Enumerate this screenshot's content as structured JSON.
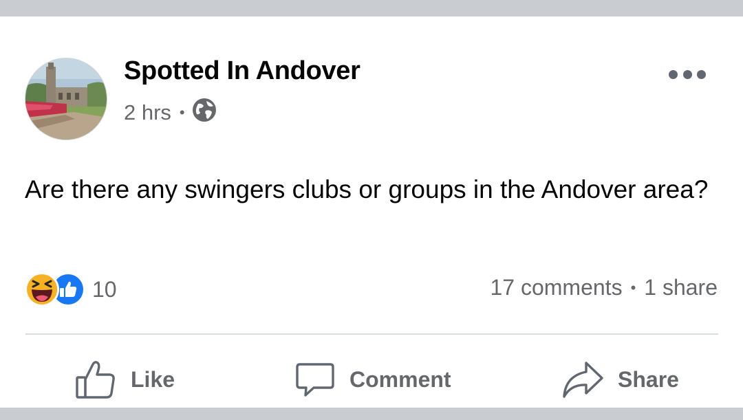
{
  "post": {
    "page_name": "Spotted In Andover",
    "time": "2 hrs",
    "separator": "•",
    "privacy_icon": "globe-icon",
    "menu_icon": "more-options-icon",
    "text": "Are there any swingers clubs or groups in the Andover area?"
  },
  "engagement": {
    "reaction_icons": [
      "haha-reaction-icon",
      "like-reaction-icon"
    ],
    "reaction_count": "10",
    "comments": "17 comments",
    "separator": "•",
    "shares": "1 share"
  },
  "actions": {
    "like_label": "Like",
    "comment_label": "Comment",
    "share_label": "Share"
  },
  "colors": {
    "background": "#c9ccd1",
    "card": "#ffffff",
    "primary_text": "#050505",
    "secondary_text": "#65676b",
    "like_blue": "#1877f2",
    "haha_yellow": "#f7b125"
  }
}
